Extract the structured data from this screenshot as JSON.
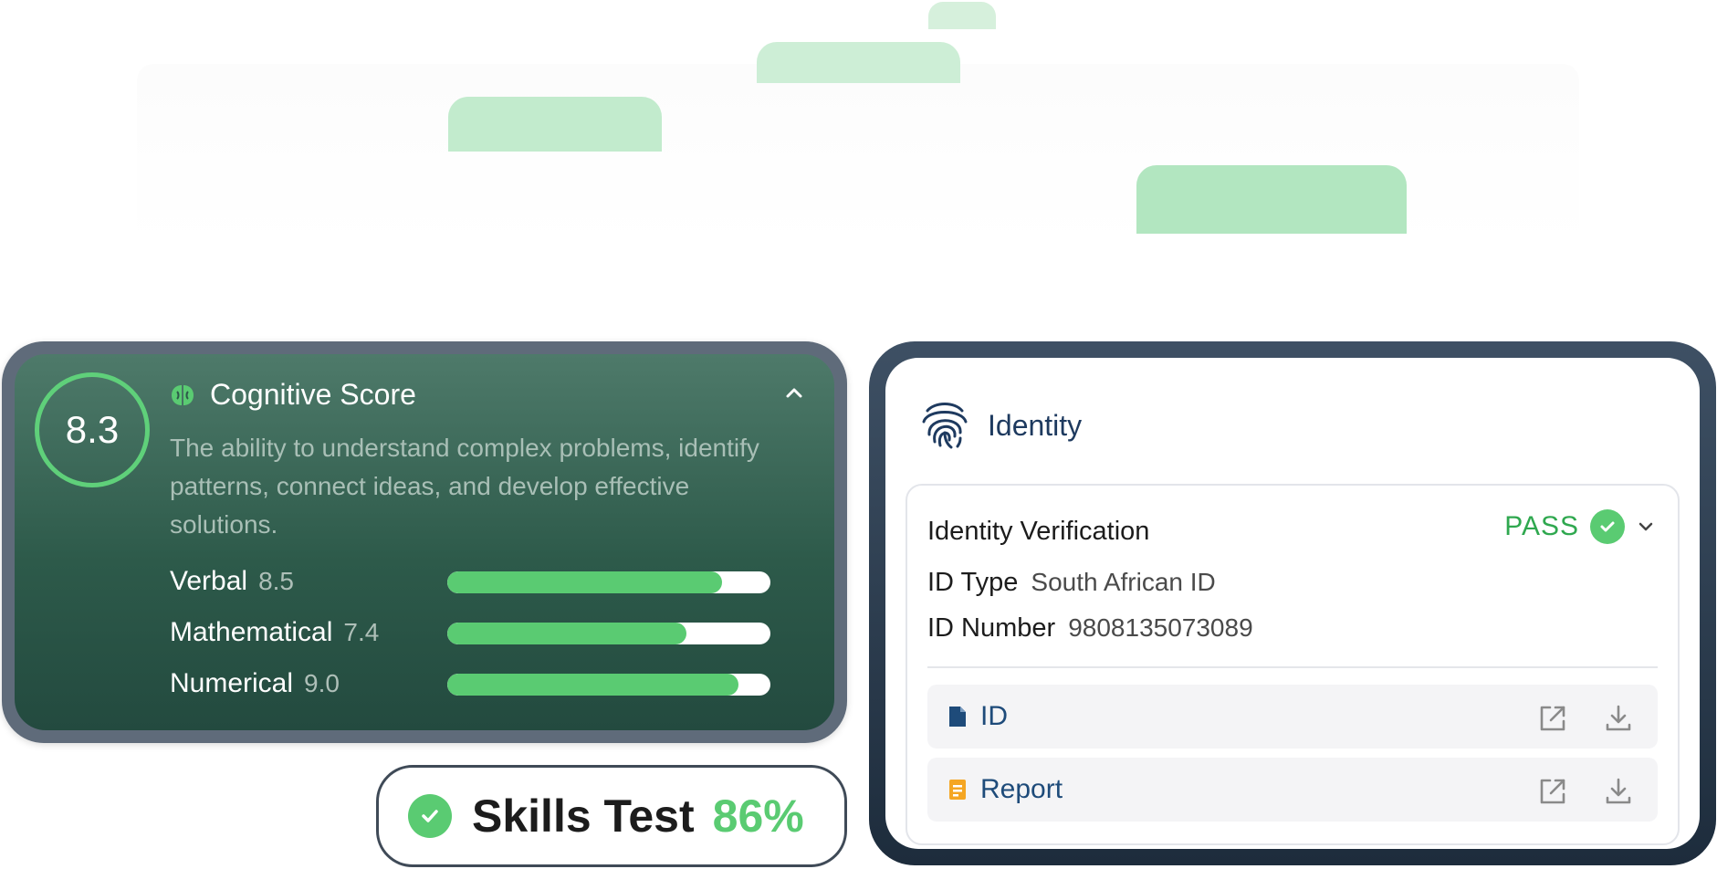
{
  "cognitive": {
    "score": "8.3",
    "title": "Cognitive Score",
    "description": "The ability to understand complex problems, identify patterns, connect ideas, and develop effective solutions.",
    "metrics": [
      {
        "label": "Verbal",
        "value": "8.5",
        "fill": 0.85
      },
      {
        "label": "Mathematical",
        "value": "7.4",
        "fill": 0.74
      },
      {
        "label": "Numerical",
        "value": "9.0",
        "fill": 0.9
      }
    ]
  },
  "skills": {
    "label": "Skills Test",
    "value": "86%"
  },
  "identity": {
    "title": "Identity",
    "verification": {
      "title": "Identity Verification",
      "status": "PASS",
      "fields": [
        {
          "label": "ID Type",
          "value": "South African ID"
        },
        {
          "label": "ID Number",
          "value": "9808135073089"
        }
      ],
      "documents": [
        {
          "label": "ID",
          "icon": "document-icon",
          "color": "#1e4b7a"
        },
        {
          "label": "Report",
          "icon": "report-icon",
          "color": "#f5a623"
        }
      ]
    }
  },
  "colors": {
    "accent_green": "#5acb72",
    "navy": "#1e3a5f"
  }
}
